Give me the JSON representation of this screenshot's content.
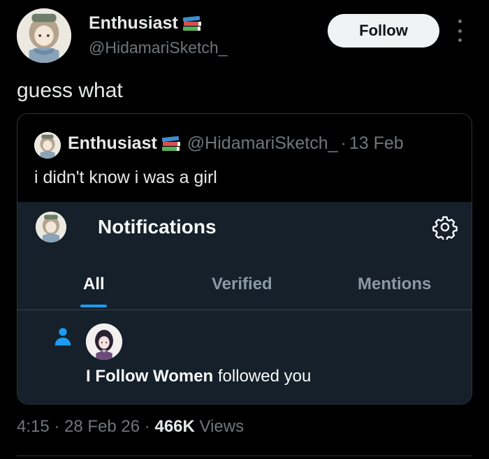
{
  "author": {
    "name": "Enthusiast",
    "handle": "@HidamariSketch_",
    "name_emoji_icon": "books-icon"
  },
  "follow_label": "Follow",
  "tweet_text": "guess what",
  "quote": {
    "name": "Enthusiast",
    "handle": "@HidamariSketch_",
    "separator": "·",
    "date": "13 Feb",
    "text": "i didn't know i was a girl"
  },
  "notifications": {
    "title": "Notifications",
    "tabs": [
      "All",
      "Verified",
      "Mentions"
    ],
    "active_tab": "All",
    "accent_color": "#1d9bf0",
    "item": {
      "follower_name": "I Follow Women",
      "action_text": " followed you"
    }
  },
  "meta": {
    "time": "4:15",
    "sep1": " · ",
    "date": "28 Feb 26",
    "sep2": " · ",
    "views_count": "466K",
    "views_label": " Views"
  }
}
